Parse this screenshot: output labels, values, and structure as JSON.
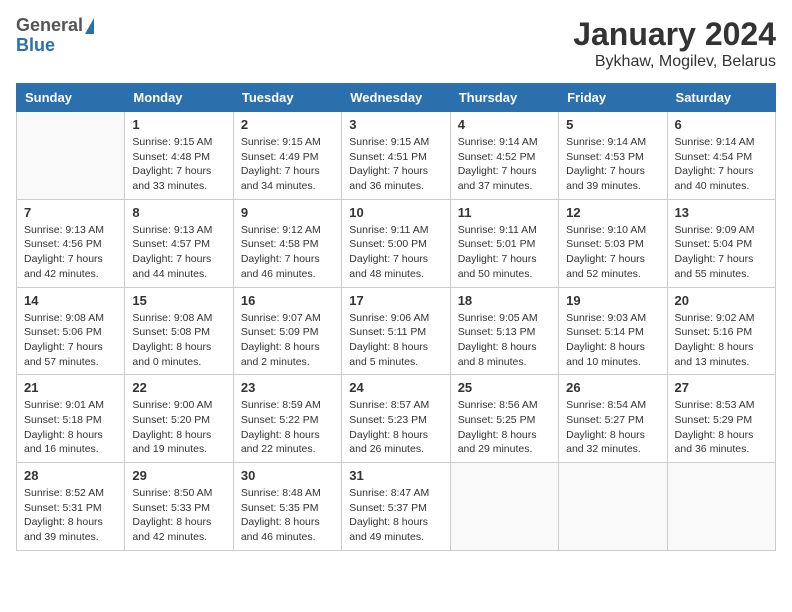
{
  "header": {
    "logo_general": "General",
    "logo_blue": "Blue",
    "title": "January 2024",
    "subtitle": "Bykhaw, Mogilev, Belarus"
  },
  "calendar": {
    "days": [
      "Sunday",
      "Monday",
      "Tuesday",
      "Wednesday",
      "Thursday",
      "Friday",
      "Saturday"
    ],
    "weeks": [
      [
        {
          "date": "",
          "empty": true
        },
        {
          "date": "1",
          "sunrise": "Sunrise: 9:15 AM",
          "sunset": "Sunset: 4:48 PM",
          "daylight": "Daylight: 7 hours",
          "daylight2": "and 33 minutes."
        },
        {
          "date": "2",
          "sunrise": "Sunrise: 9:15 AM",
          "sunset": "Sunset: 4:49 PM",
          "daylight": "Daylight: 7 hours",
          "daylight2": "and 34 minutes."
        },
        {
          "date": "3",
          "sunrise": "Sunrise: 9:15 AM",
          "sunset": "Sunset: 4:51 PM",
          "daylight": "Daylight: 7 hours",
          "daylight2": "and 36 minutes."
        },
        {
          "date": "4",
          "sunrise": "Sunrise: 9:14 AM",
          "sunset": "Sunset: 4:52 PM",
          "daylight": "Daylight: 7 hours",
          "daylight2": "and 37 minutes."
        },
        {
          "date": "5",
          "sunrise": "Sunrise: 9:14 AM",
          "sunset": "Sunset: 4:53 PM",
          "daylight": "Daylight: 7 hours",
          "daylight2": "and 39 minutes."
        },
        {
          "date": "6",
          "sunrise": "Sunrise: 9:14 AM",
          "sunset": "Sunset: 4:54 PM",
          "daylight": "Daylight: 7 hours",
          "daylight2": "and 40 minutes."
        }
      ],
      [
        {
          "date": "7",
          "sunrise": "Sunrise: 9:13 AM",
          "sunset": "Sunset: 4:56 PM",
          "daylight": "Daylight: 7 hours",
          "daylight2": "and 42 minutes."
        },
        {
          "date": "8",
          "sunrise": "Sunrise: 9:13 AM",
          "sunset": "Sunset: 4:57 PM",
          "daylight": "Daylight: 7 hours",
          "daylight2": "and 44 minutes."
        },
        {
          "date": "9",
          "sunrise": "Sunrise: 9:12 AM",
          "sunset": "Sunset: 4:58 PM",
          "daylight": "Daylight: 7 hours",
          "daylight2": "and 46 minutes."
        },
        {
          "date": "10",
          "sunrise": "Sunrise: 9:11 AM",
          "sunset": "Sunset: 5:00 PM",
          "daylight": "Daylight: 7 hours",
          "daylight2": "and 48 minutes."
        },
        {
          "date": "11",
          "sunrise": "Sunrise: 9:11 AM",
          "sunset": "Sunset: 5:01 PM",
          "daylight": "Daylight: 7 hours",
          "daylight2": "and 50 minutes."
        },
        {
          "date": "12",
          "sunrise": "Sunrise: 9:10 AM",
          "sunset": "Sunset: 5:03 PM",
          "daylight": "Daylight: 7 hours",
          "daylight2": "and 52 minutes."
        },
        {
          "date": "13",
          "sunrise": "Sunrise: 9:09 AM",
          "sunset": "Sunset: 5:04 PM",
          "daylight": "Daylight: 7 hours",
          "daylight2": "and 55 minutes."
        }
      ],
      [
        {
          "date": "14",
          "sunrise": "Sunrise: 9:08 AM",
          "sunset": "Sunset: 5:06 PM",
          "daylight": "Daylight: 7 hours",
          "daylight2": "and 57 minutes."
        },
        {
          "date": "15",
          "sunrise": "Sunrise: 9:08 AM",
          "sunset": "Sunset: 5:08 PM",
          "daylight": "Daylight: 8 hours",
          "daylight2": "and 0 minutes."
        },
        {
          "date": "16",
          "sunrise": "Sunrise: 9:07 AM",
          "sunset": "Sunset: 5:09 PM",
          "daylight": "Daylight: 8 hours",
          "daylight2": "and 2 minutes."
        },
        {
          "date": "17",
          "sunrise": "Sunrise: 9:06 AM",
          "sunset": "Sunset: 5:11 PM",
          "daylight": "Daylight: 8 hours",
          "daylight2": "and 5 minutes."
        },
        {
          "date": "18",
          "sunrise": "Sunrise: 9:05 AM",
          "sunset": "Sunset: 5:13 PM",
          "daylight": "Daylight: 8 hours",
          "daylight2": "and 8 minutes."
        },
        {
          "date": "19",
          "sunrise": "Sunrise: 9:03 AM",
          "sunset": "Sunset: 5:14 PM",
          "daylight": "Daylight: 8 hours",
          "daylight2": "and 10 minutes."
        },
        {
          "date": "20",
          "sunrise": "Sunrise: 9:02 AM",
          "sunset": "Sunset: 5:16 PM",
          "daylight": "Daylight: 8 hours",
          "daylight2": "and 13 minutes."
        }
      ],
      [
        {
          "date": "21",
          "sunrise": "Sunrise: 9:01 AM",
          "sunset": "Sunset: 5:18 PM",
          "daylight": "Daylight: 8 hours",
          "daylight2": "and 16 minutes."
        },
        {
          "date": "22",
          "sunrise": "Sunrise: 9:00 AM",
          "sunset": "Sunset: 5:20 PM",
          "daylight": "Daylight: 8 hours",
          "daylight2": "and 19 minutes."
        },
        {
          "date": "23",
          "sunrise": "Sunrise: 8:59 AM",
          "sunset": "Sunset: 5:22 PM",
          "daylight": "Daylight: 8 hours",
          "daylight2": "and 22 minutes."
        },
        {
          "date": "24",
          "sunrise": "Sunrise: 8:57 AM",
          "sunset": "Sunset: 5:23 PM",
          "daylight": "Daylight: 8 hours",
          "daylight2": "and 26 minutes."
        },
        {
          "date": "25",
          "sunrise": "Sunrise: 8:56 AM",
          "sunset": "Sunset: 5:25 PM",
          "daylight": "Daylight: 8 hours",
          "daylight2": "and 29 minutes."
        },
        {
          "date": "26",
          "sunrise": "Sunrise: 8:54 AM",
          "sunset": "Sunset: 5:27 PM",
          "daylight": "Daylight: 8 hours",
          "daylight2": "and 32 minutes."
        },
        {
          "date": "27",
          "sunrise": "Sunrise: 8:53 AM",
          "sunset": "Sunset: 5:29 PM",
          "daylight": "Daylight: 8 hours",
          "daylight2": "and 36 minutes."
        }
      ],
      [
        {
          "date": "28",
          "sunrise": "Sunrise: 8:52 AM",
          "sunset": "Sunset: 5:31 PM",
          "daylight": "Daylight: 8 hours",
          "daylight2": "and 39 minutes."
        },
        {
          "date": "29",
          "sunrise": "Sunrise: 8:50 AM",
          "sunset": "Sunset: 5:33 PM",
          "daylight": "Daylight: 8 hours",
          "daylight2": "and 42 minutes."
        },
        {
          "date": "30",
          "sunrise": "Sunrise: 8:48 AM",
          "sunset": "Sunset: 5:35 PM",
          "daylight": "Daylight: 8 hours",
          "daylight2": "and 46 minutes."
        },
        {
          "date": "31",
          "sunrise": "Sunrise: 8:47 AM",
          "sunset": "Sunset: 5:37 PM",
          "daylight": "Daylight: 8 hours",
          "daylight2": "and 49 minutes."
        },
        {
          "date": "",
          "empty": true
        },
        {
          "date": "",
          "empty": true
        },
        {
          "date": "",
          "empty": true
        }
      ]
    ]
  }
}
